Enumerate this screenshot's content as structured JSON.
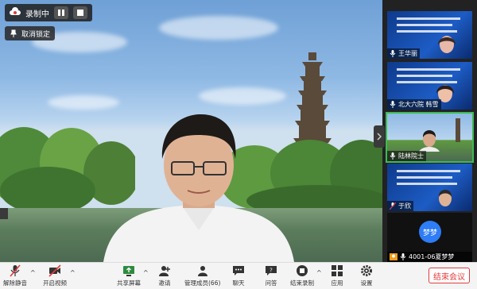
{
  "recording": {
    "label": "录制中",
    "unlock_label": "取消锁定"
  },
  "participants": [
    {
      "name": "王华丽",
      "mic": "mic-icon"
    },
    {
      "name": "北大六院 韩雪",
      "mic": "mic-icon"
    },
    {
      "name": "陆林院士",
      "mic": "mic-icon",
      "active": true
    },
    {
      "name": "于欣",
      "mic": "mic-muted-icon"
    }
  ],
  "self_tile": {
    "avatar_text": "梦梦",
    "name": "4001-06夏梦梦"
  },
  "toolbar": {
    "mute_label": "解除静音",
    "video_label": "开启视频",
    "share_label": "共享屏幕",
    "invite_label": "邀请",
    "members_label": "管理成员(66)",
    "chat_label": "聊天",
    "qa_label": "问答",
    "record_label": "结束录制",
    "apps_label": "应用",
    "settings_label": "设置",
    "end_label": "结束会议"
  },
  "colors": {
    "accent_green": "#3dbb54",
    "end_red": "#e23b3b",
    "avatar_blue": "#2e7cf6"
  }
}
